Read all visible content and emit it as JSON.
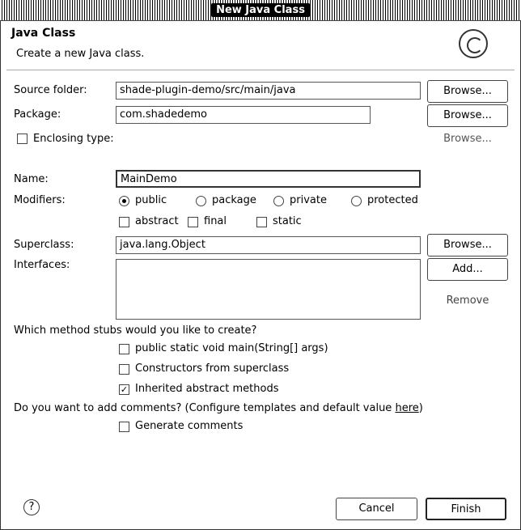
{
  "window": {
    "title": "New Java Class"
  },
  "header": {
    "title": "Java Class",
    "description": "Create a new Java class.",
    "icon": "java-class-wizard-icon"
  },
  "source_folder": {
    "label": "Source folder:",
    "value": "shade-plugin-demo/src/main/java",
    "browse": "Browse..."
  },
  "package": {
    "label": "Package:",
    "value": "com.shadedemo",
    "browse": "Browse..."
  },
  "enclosing": {
    "label": "Enclosing type:",
    "checked": false,
    "browse": "Browse..."
  },
  "name": {
    "label": "Name:",
    "value": "MainDemo"
  },
  "modifiers": {
    "label": "Modifiers:",
    "access": [
      {
        "label": "public",
        "selected": true
      },
      {
        "label": "package",
        "selected": false
      },
      {
        "label": "private",
        "selected": false
      },
      {
        "label": "protected",
        "selected": false
      }
    ],
    "extra": [
      {
        "label": "abstract",
        "checked": false
      },
      {
        "label": "final",
        "checked": false
      },
      {
        "label": "static",
        "checked": false
      }
    ]
  },
  "superclass": {
    "label": "Superclass:",
    "value": "java.lang.Object",
    "browse": "Browse..."
  },
  "interfaces": {
    "label": "Interfaces:",
    "add": "Add...",
    "remove": "Remove"
  },
  "stubs": {
    "question": "Which method stubs would you like to create?",
    "options": [
      {
        "label": "public static void main(String[] args)",
        "checked": false
      },
      {
        "label": "Constructors from superclass",
        "checked": false
      },
      {
        "label": "Inherited abstract methods",
        "checked": true
      }
    ]
  },
  "comments": {
    "question_prefix": "Do you want to add comments? (Configure templates and default value ",
    "link": "here",
    "question_suffix": ")",
    "option": {
      "label": "Generate comments",
      "checked": false
    }
  },
  "footer": {
    "help": "?",
    "cancel": "Cancel",
    "finish": "Finish"
  }
}
